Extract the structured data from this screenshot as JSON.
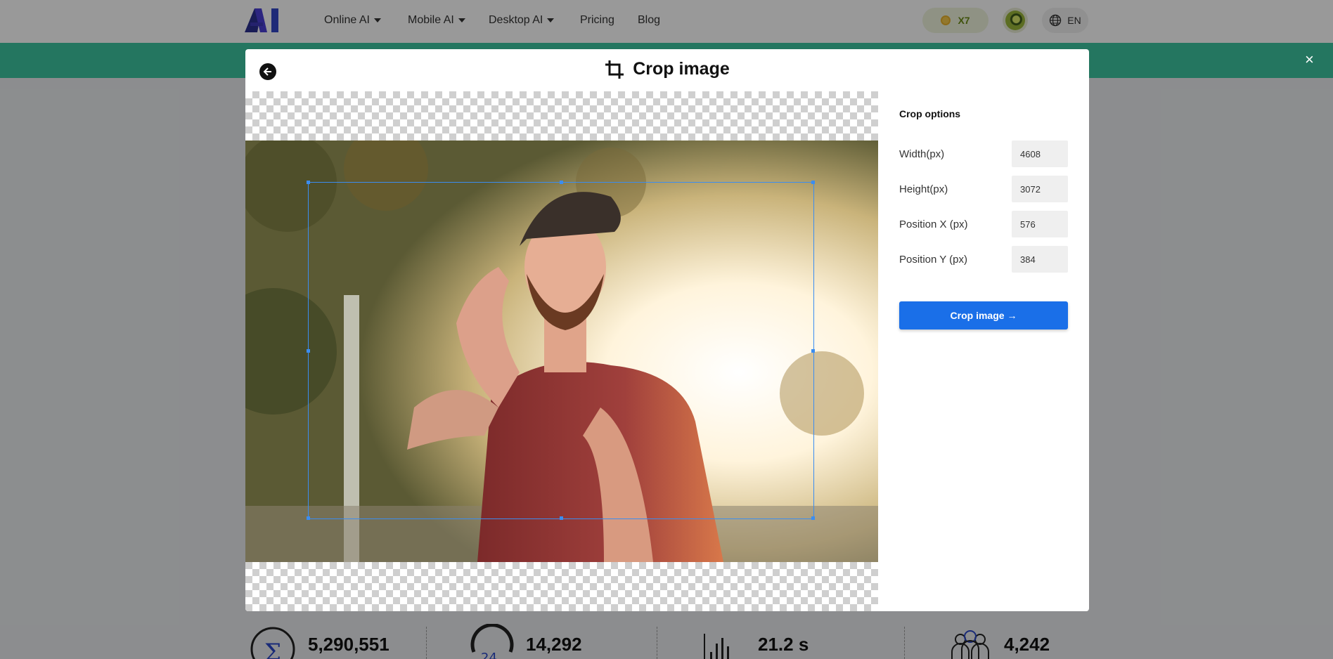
{
  "topnav": {
    "logo_text": "AI",
    "items": [
      {
        "label": "Online AI",
        "dropdown": true
      },
      {
        "label": "Mobile AI",
        "dropdown": true
      },
      {
        "label": "Desktop AI",
        "dropdown": true
      },
      {
        "label": "Pricing",
        "dropdown": false
      },
      {
        "label": "Blog",
        "dropdown": false
      }
    ],
    "coins_label": "X7",
    "language": "EN"
  },
  "banner": {
    "close_icon": "×"
  },
  "stats": [
    {
      "icon": "sigma-icon",
      "value": "5,290,551"
    },
    {
      "icon": "clock-24h-icon",
      "value": "14,292"
    },
    {
      "icon": "bar-chart-icon",
      "value": "21.2 s"
    },
    {
      "icon": "users-icon",
      "value": "4,242"
    }
  ],
  "modal": {
    "title": "Crop image",
    "side": {
      "title": "Crop options",
      "fields": [
        {
          "label": "Width(px)",
          "value": "4608"
        },
        {
          "label": "Height(px)",
          "value": "3072"
        },
        {
          "label": "Position X (px)",
          "value": "576"
        },
        {
          "label": "Position Y (px)",
          "value": "384"
        }
      ],
      "button_label": "Crop image →"
    }
  },
  "colors": {
    "accent_blue": "#1a6fe8",
    "banner_teal": "#3dc5a0",
    "crop_border": "#3b8df0"
  }
}
